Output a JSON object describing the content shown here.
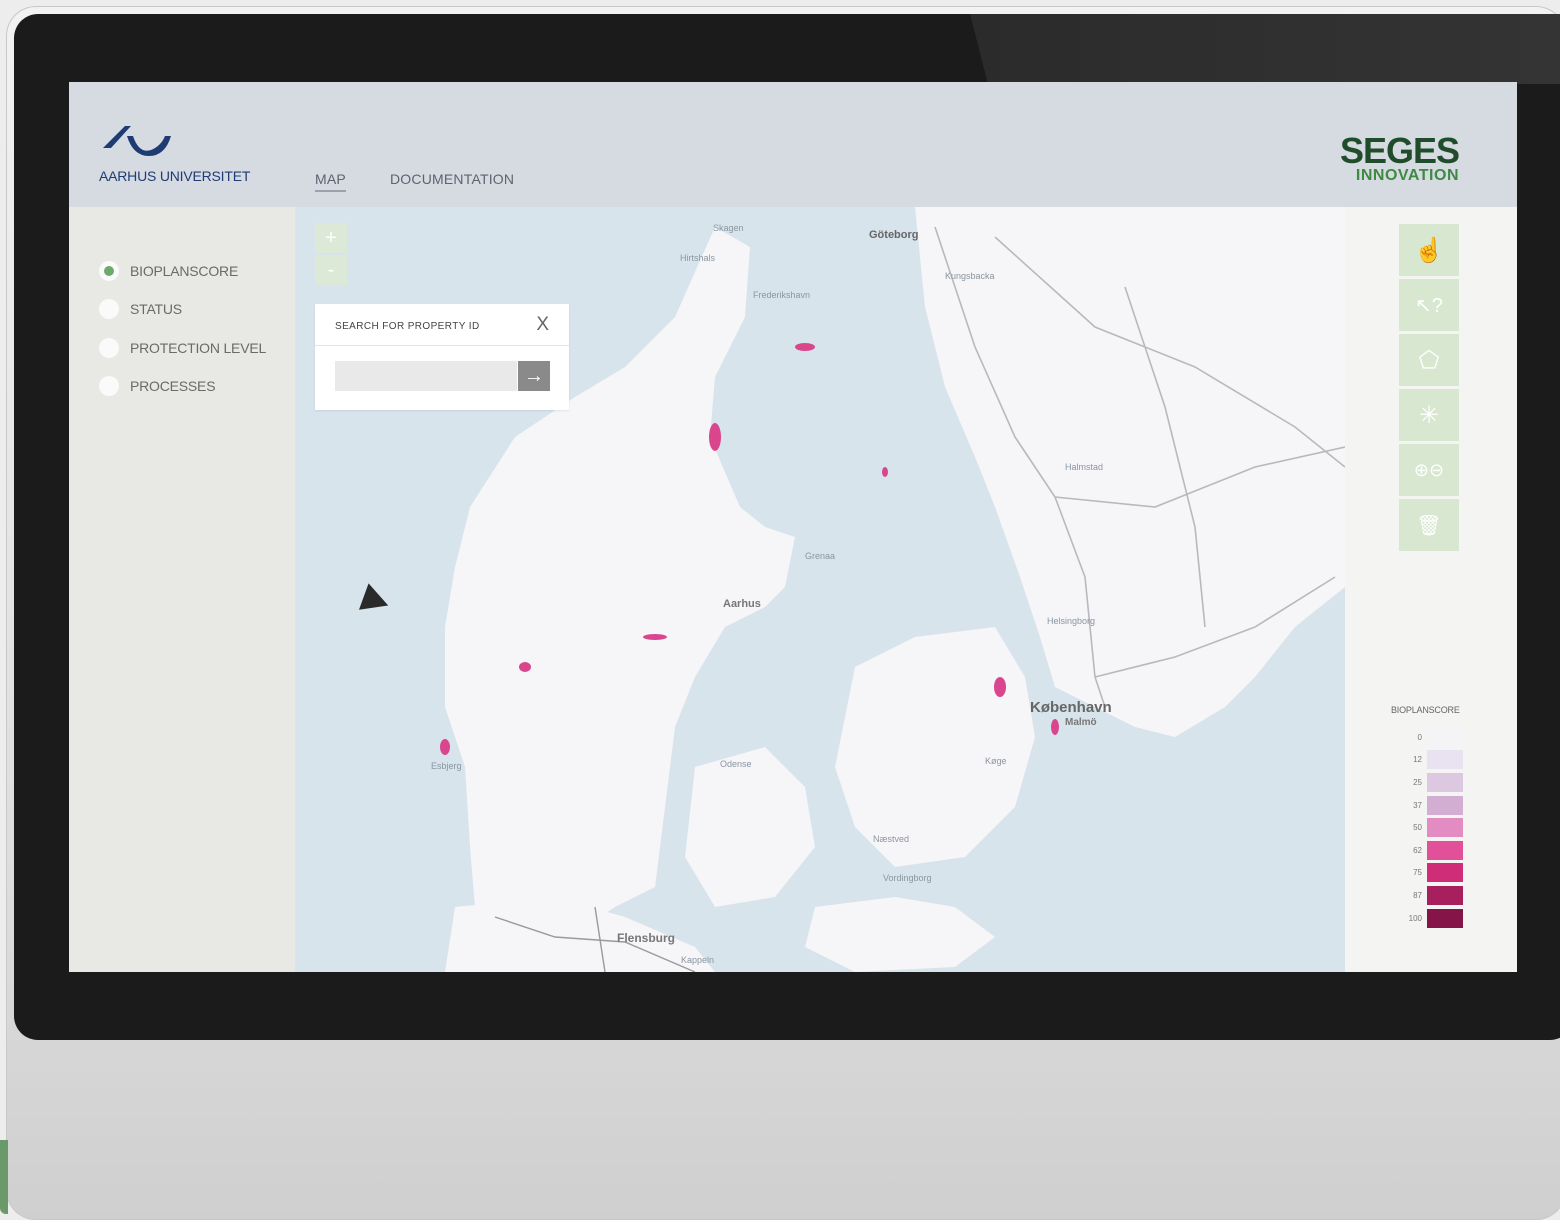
{
  "header": {
    "university": "AARHUS UNIVERSITET",
    "nav": {
      "map": "MAP",
      "documentation": "DOCUMENTATION"
    },
    "partner": {
      "top": "SEGES",
      "bottom": "INNOVATION"
    }
  },
  "layers": [
    {
      "label": "BIOPLANSCORE",
      "selected": true
    },
    {
      "label": "STATUS",
      "selected": false
    },
    {
      "label": "PROTECTION LEVEL",
      "selected": false
    },
    {
      "label": "PROCESSES",
      "selected": false
    }
  ],
  "zoom": {
    "in": "+",
    "out": "-"
  },
  "search": {
    "title": "SEARCH FOR PROPERTY ID",
    "close": "X",
    "value": "",
    "go": "→"
  },
  "map_labels": {
    "skagen": "Skagen",
    "hirtshals": "Hirtshals",
    "frederikshavn": "Frederikshavn",
    "goteborg": "Göteborg",
    "kungsbacka": "Kungsbacka",
    "halmstad": "Halmstad",
    "grenaa": "Grenaa",
    "aarhus": "Aarhus",
    "esbjerg": "Esbjerg",
    "flensburg": "Flensburg",
    "kobenhavn": "København",
    "malmo": "Malmö",
    "helsingborg": "Helsingborg",
    "koge": "Køge",
    "naestved": "Næstved",
    "vordingborg": "Vordingborg",
    "odense": "Odense",
    "kappeln": "Kappeln"
  },
  "tools": [
    {
      "icon": "hand-icon",
      "glyph": "☝"
    },
    {
      "icon": "pointer-question-icon",
      "glyph": "↖?"
    },
    {
      "icon": "polygon-icon",
      "glyph": "⬠"
    },
    {
      "icon": "magic-wand-icon",
      "glyph": "✳"
    },
    {
      "icon": "add-remove-icon",
      "glyph": "⊕⊖"
    },
    {
      "icon": "trash-icon",
      "glyph": "🗑"
    }
  ],
  "legend": {
    "title": "BIOPLANSCORE",
    "items": [
      {
        "value": "0",
        "color": "#f4f4f6"
      },
      {
        "value": "12",
        "color": "#e9e2f0"
      },
      {
        "value": "25",
        "color": "#ddc8e2"
      },
      {
        "value": "37",
        "color": "#d3aed3"
      },
      {
        "value": "50",
        "color": "#e28cc1"
      },
      {
        "value": "62",
        "color": "#e3509a"
      },
      {
        "value": "75",
        "color": "#cf2d78"
      },
      {
        "value": "87",
        "color": "#a81f5d"
      },
      {
        "value": "100",
        "color": "#851449"
      }
    ]
  }
}
